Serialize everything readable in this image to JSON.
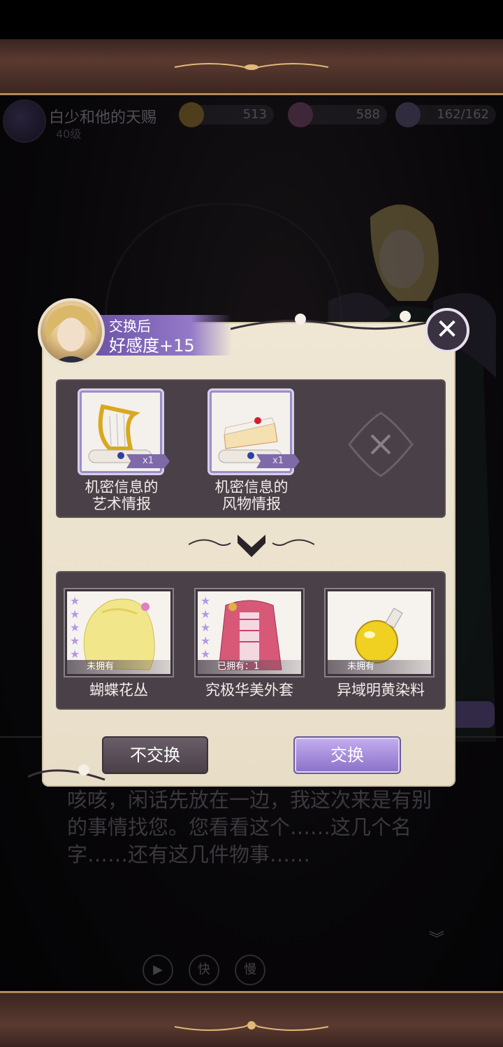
{
  "status": {
    "title": "白少和他的天赐",
    "subtitle": "40级",
    "gold": "513",
    "diamond": "588",
    "stamina": "162/162"
  },
  "dialogue": {
    "text": "咳咳，闲话先放在一边，我这次来是有别的事情找您。您看看这个……这几个名字……还有这几件物事……"
  },
  "controls": {
    "play_icon": "play-icon",
    "fast_label": "快",
    "slow_label": "慢"
  },
  "modal": {
    "header_small": "交换后",
    "header_big": "好感度+15",
    "close_icon": "close-icon",
    "cost_items": [
      {
        "name_line1": "机密信息的",
        "name_line2": "艺术情报",
        "qty": "x1",
        "icon": "harp-scroll-icon"
      },
      {
        "name_line1": "机密信息的",
        "name_line2": "风物情报",
        "qty": "x1",
        "icon": "cake-scroll-icon"
      }
    ],
    "rewards": [
      {
        "name": "蝴蝶花丛",
        "ownership": "未拥有",
        "stars": 5,
        "icon": "blonde-wig-icon"
      },
      {
        "name": "究极华美外套",
        "ownership": "已拥有：1",
        "stars": 5,
        "icon": "pink-coat-icon"
      },
      {
        "name": "异域明黄染料",
        "ownership": "未拥有",
        "stars": 0,
        "icon": "yellow-potion-icon"
      }
    ],
    "buttons": {
      "decline": "不交换",
      "confirm": "交换"
    }
  },
  "colors": {
    "accent_purple": "#8a70c8",
    "parchment": "#efe7d4",
    "panel": "#4a4048"
  }
}
